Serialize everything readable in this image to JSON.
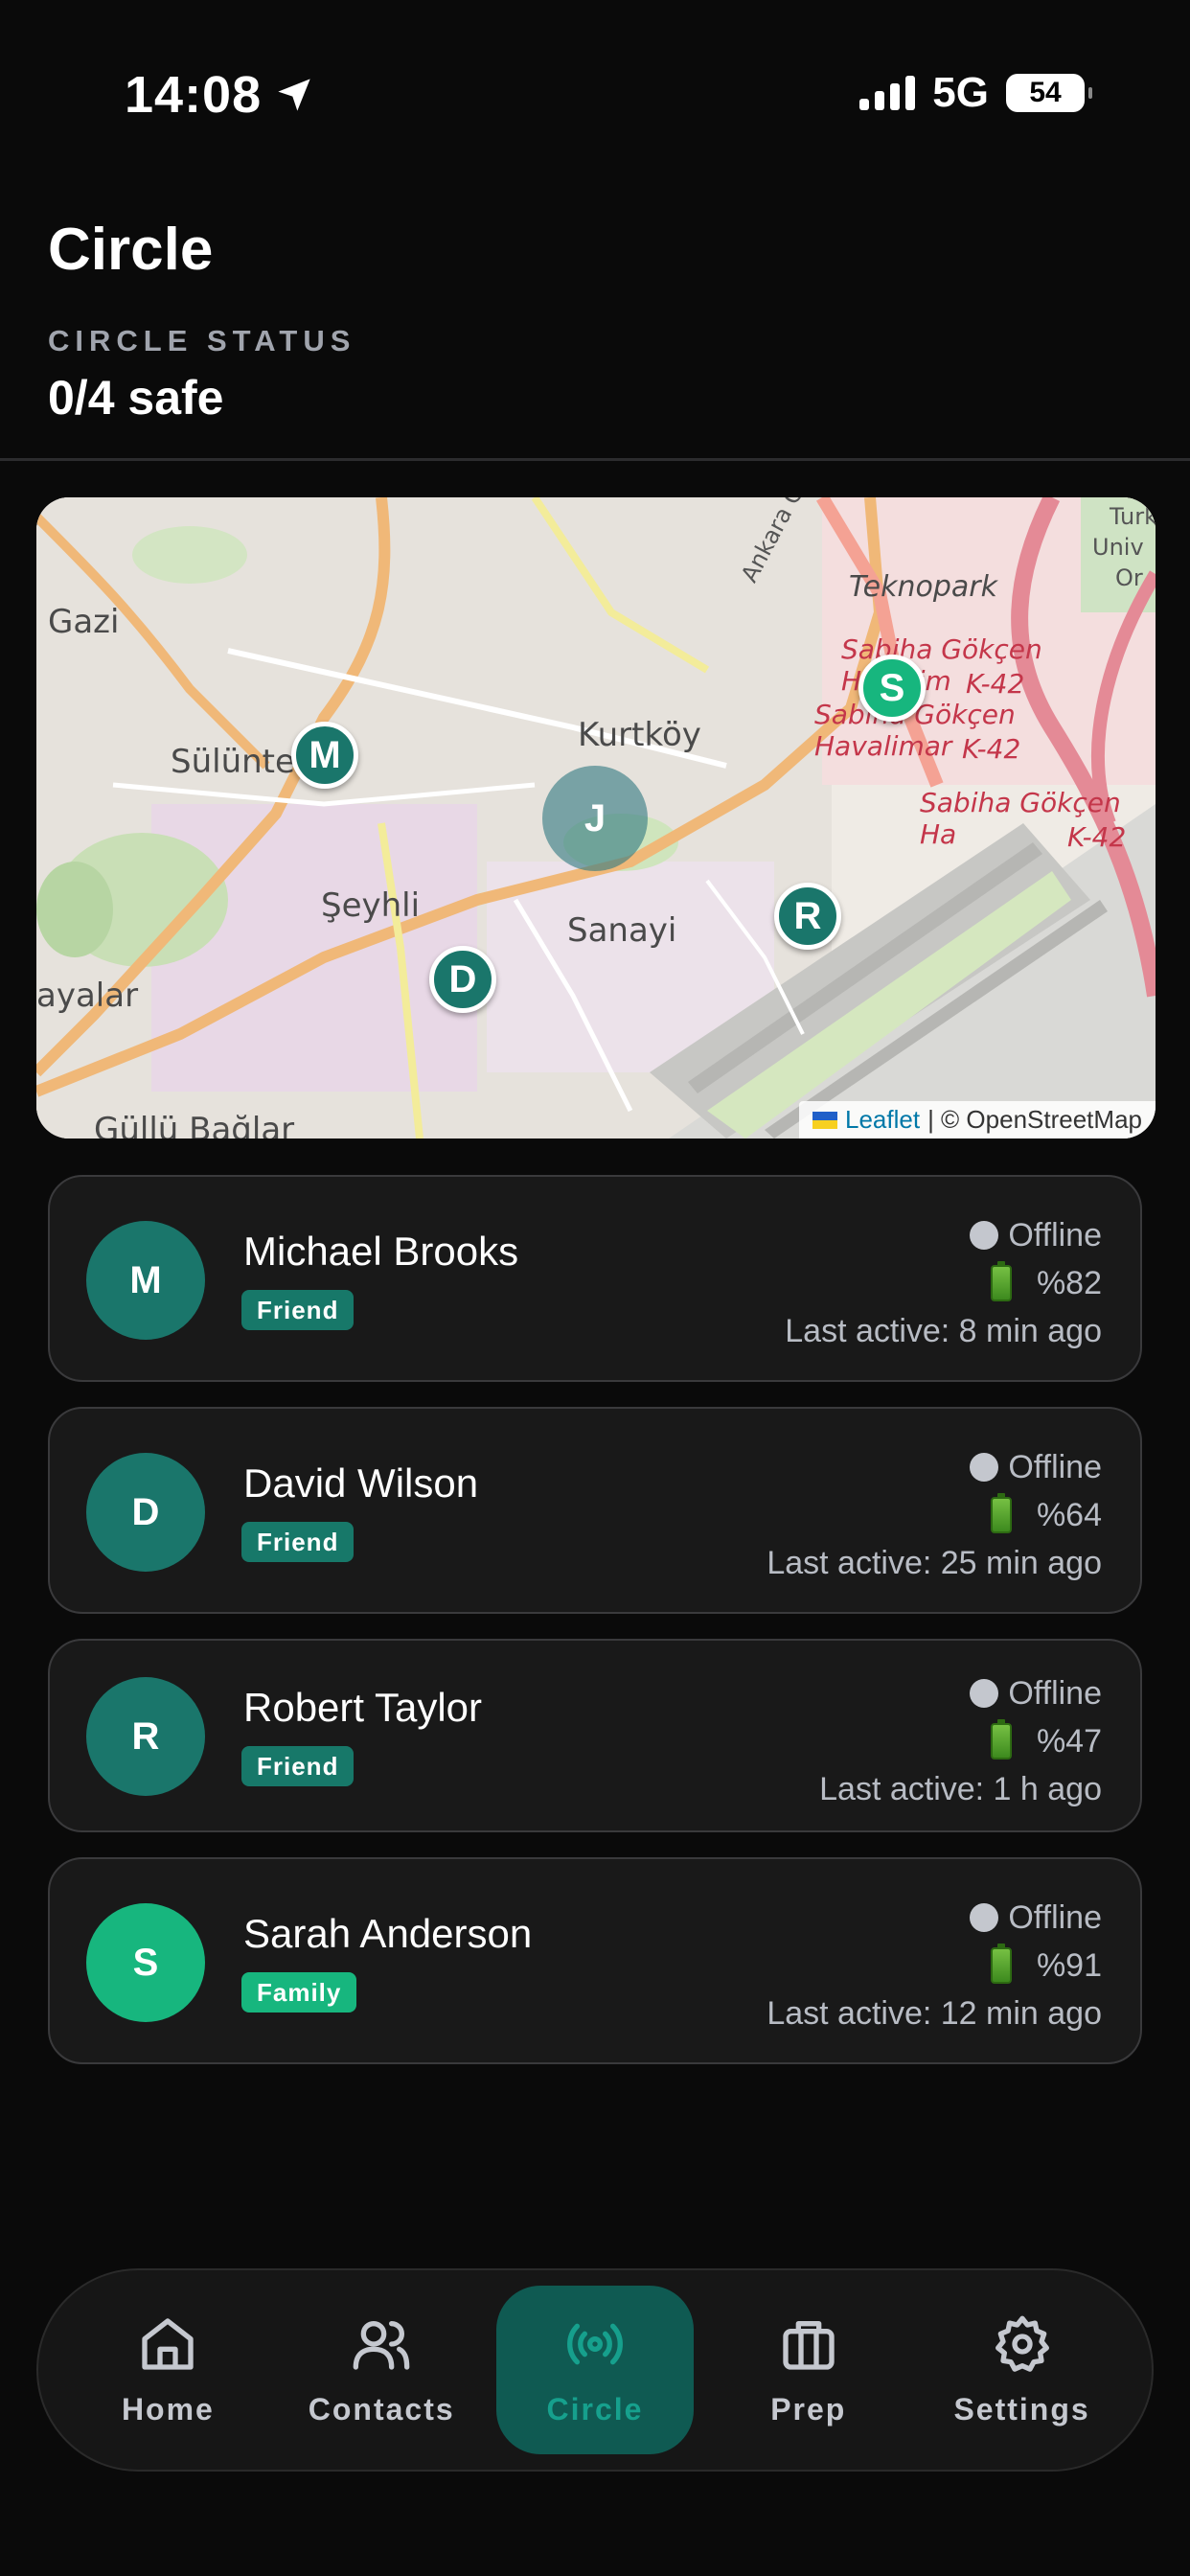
{
  "status_bar": {
    "time": "14:08",
    "network": "5G",
    "battery": "54"
  },
  "header": {
    "title": "Circle",
    "status_label": "CIRCLE STATUS",
    "status_value": "0/4 safe"
  },
  "map": {
    "labels": [
      "Gazi",
      "Sülünte",
      "Kurtköy",
      "Şeyhli",
      "Sanayi",
      "ayalar",
      "Güllü Bağlar",
      "Teknopark",
      "Ankara Caddesi",
      "Sabiha Gökçen Havalim",
      "Sabiha Gökçen Havalimar",
      "Sabiha Gökçen Ha",
      "K-42",
      "K-42",
      "K-42",
      "Turk",
      "Univ",
      "Or"
    ],
    "markers": [
      "M",
      "J",
      "D",
      "R",
      "S"
    ],
    "attribution_leaflet": "Leaflet",
    "attribution_osm": "| © OpenStreetMap"
  },
  "members": [
    {
      "initial": "M",
      "name": "Michael Brooks",
      "tag": "Friend",
      "status": "Offline",
      "battery": "%82",
      "last_active": "Last active: 8 min ago"
    },
    {
      "initial": "D",
      "name": "David Wilson",
      "tag": "Friend",
      "status": "Offline",
      "battery": "%64",
      "last_active": "Last active: 25 min ago"
    },
    {
      "initial": "R",
      "name": "Robert Taylor",
      "tag": "Friend",
      "status": "Offline",
      "battery": "%47",
      "last_active": "Last active: 1 h ago"
    },
    {
      "initial": "S",
      "name": "Sarah Anderson",
      "tag": "Family",
      "status": "Offline",
      "battery": "%91",
      "last_active": "Last active: 12 min ago"
    }
  ],
  "tabs": [
    {
      "label": "Home",
      "icon": "home-icon"
    },
    {
      "label": "Contacts",
      "icon": "contacts-icon"
    },
    {
      "label": "Circle",
      "icon": "broadcast-icon"
    },
    {
      "label": "Prep",
      "icon": "briefcase-icon"
    },
    {
      "label": "Settings",
      "icon": "gear-icon"
    }
  ],
  "colors": {
    "background": "#0a0a0a",
    "accent": "#1a766b",
    "family": "#17b67e",
    "card": "#191919"
  }
}
